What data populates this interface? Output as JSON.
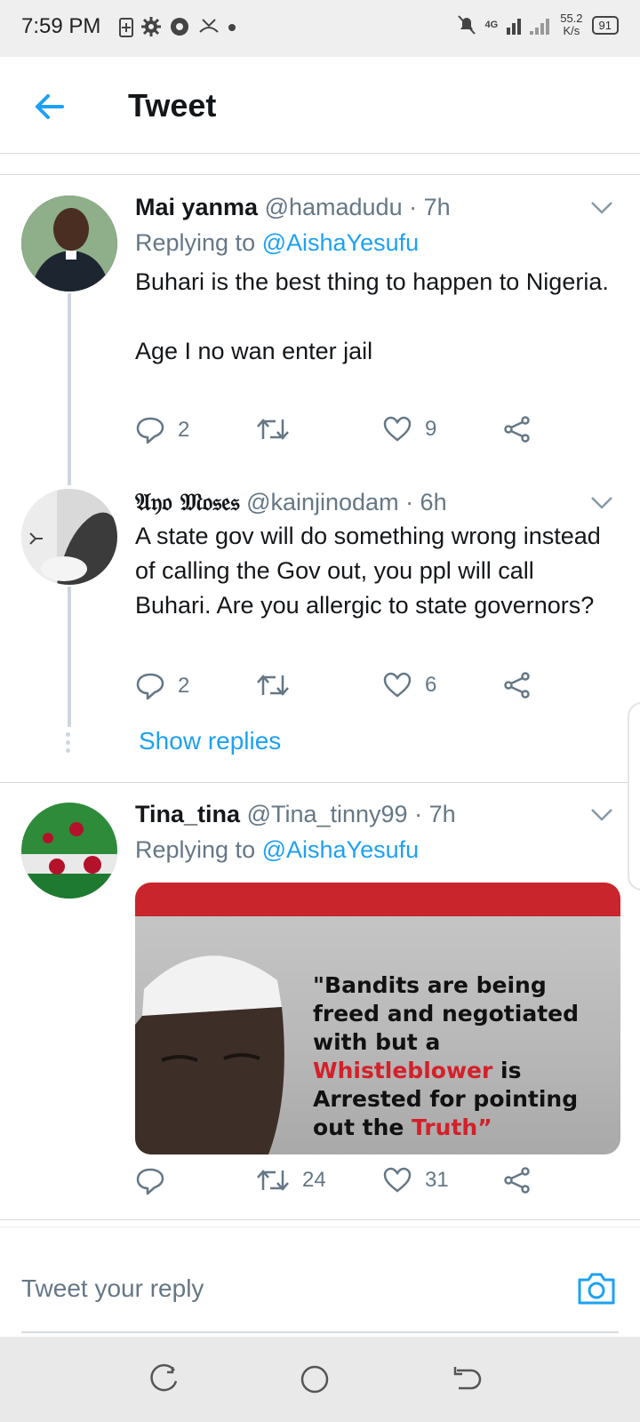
{
  "status_bar": {
    "time": "7:59 PM",
    "network": "4G",
    "speed_value": "55.2",
    "speed_unit": "K/s",
    "battery": "91"
  },
  "header": {
    "title": "Tweet"
  },
  "tweets": [
    {
      "name": "Mai yanma",
      "handle": "@hamadudu",
      "time": " · 7h",
      "replying_prefix": "Replying to ",
      "replying_to": "@AishaYesufu",
      "text": "Buhari is the best thing to happen to Nigeria.\n\nAge I no wan enter jail",
      "replies": "2",
      "retweets": "",
      "likes": "9"
    },
    {
      "name": "𝔄𝔶𝔬 𝔐𝔬𝔰𝔢𝔰",
      "handle": "@kainjinodam",
      "time": " · 6h",
      "text": "A state gov will do something wrong instead of calling the Gov out, you ppl will call Buhari. Are you allergic to state governors?",
      "replies": "2",
      "retweets": "",
      "likes": "6",
      "show_replies": "Show replies"
    },
    {
      "name": "Tina_tina",
      "handle": "@Tina_tinny99",
      "time": " · 7h",
      "replying_prefix": "Replying to ",
      "replying_to": "@AishaYesufu",
      "media_quote": {
        "line1": "\"Bandits are being freed and negotiated with but a",
        "red1": "Whistleblower",
        "line2": " is Arrested for pointing out the ",
        "red2": "Truth",
        "close": "”"
      },
      "replies": "",
      "retweets": "24",
      "likes": "31"
    }
  ],
  "reply_bar": {
    "placeholder": "Tweet your reply"
  },
  "colors": {
    "accent": "#1da1f2",
    "muted": "#657786",
    "text": "#14171a"
  }
}
